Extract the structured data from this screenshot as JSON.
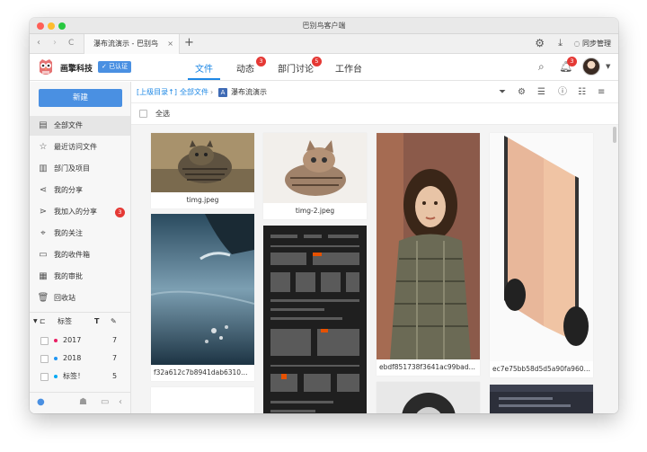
{
  "window": {
    "title": "巴别鸟客户端"
  },
  "browser": {
    "tab_title": "瀑布流演示 - 巴别鸟",
    "tab_close": "×",
    "new_tab": "+",
    "back": "‹",
    "forward": "›",
    "reload": "C",
    "sync_label": "同步管理"
  },
  "app": {
    "brand": "画擎科技",
    "verified_label": "已认证",
    "nav": [
      {
        "label": "文件"
      },
      {
        "label": "动态",
        "badge": "3"
      },
      {
        "label": "部门讨论",
        "badge": "5"
      },
      {
        "label": "工作台"
      }
    ],
    "notification_badge": "3"
  },
  "sidebar": {
    "new_button": "新建",
    "items": [
      {
        "label": "全部文件",
        "icon": "folder-icon"
      },
      {
        "label": "最近访问文件",
        "icon": "star-icon"
      },
      {
        "label": "部门及项目",
        "icon": "building-icon"
      },
      {
        "label": "我的分享",
        "icon": "share-icon"
      },
      {
        "label": "我加入的分享",
        "icon": "joined-share-icon",
        "badge": "3"
      },
      {
        "label": "我的关注",
        "icon": "focus-icon"
      },
      {
        "label": "我的收件箱",
        "icon": "inbox-icon"
      },
      {
        "label": "我的审批",
        "icon": "approval-icon"
      },
      {
        "label": "回收站",
        "icon": "trash-icon"
      }
    ],
    "tags_header": "标签",
    "tags": [
      {
        "label": "2017",
        "count": "7",
        "color": "#e91e63"
      },
      {
        "label": "2018",
        "count": "7",
        "color": "#2196f3"
      },
      {
        "label": "标签！",
        "count": "5",
        "color": "#03a9f4"
      }
    ]
  },
  "breadcrumb": {
    "up": "[上级目录↑]",
    "root": "全部文件",
    "separator": "›",
    "current": "瀑布流演示"
  },
  "select_all": "全选",
  "files": [
    {
      "name": "timg.jpeg"
    },
    {
      "name": "timg-2.jpeg"
    },
    {
      "name": "ebdf851738f3641ac99bad620..."
    },
    {
      "name": "ec7e75bb58d5d5a90fa960bf5..."
    },
    {
      "name": "f32a612c7b8941dab63109aaa..."
    },
    {
      "name": ""
    },
    {
      "name": ""
    },
    {
      "name": ""
    }
  ],
  "colors": {
    "accent": "#1e88e5",
    "badge": "#e53935",
    "primary_button": "#4a90e2"
  }
}
